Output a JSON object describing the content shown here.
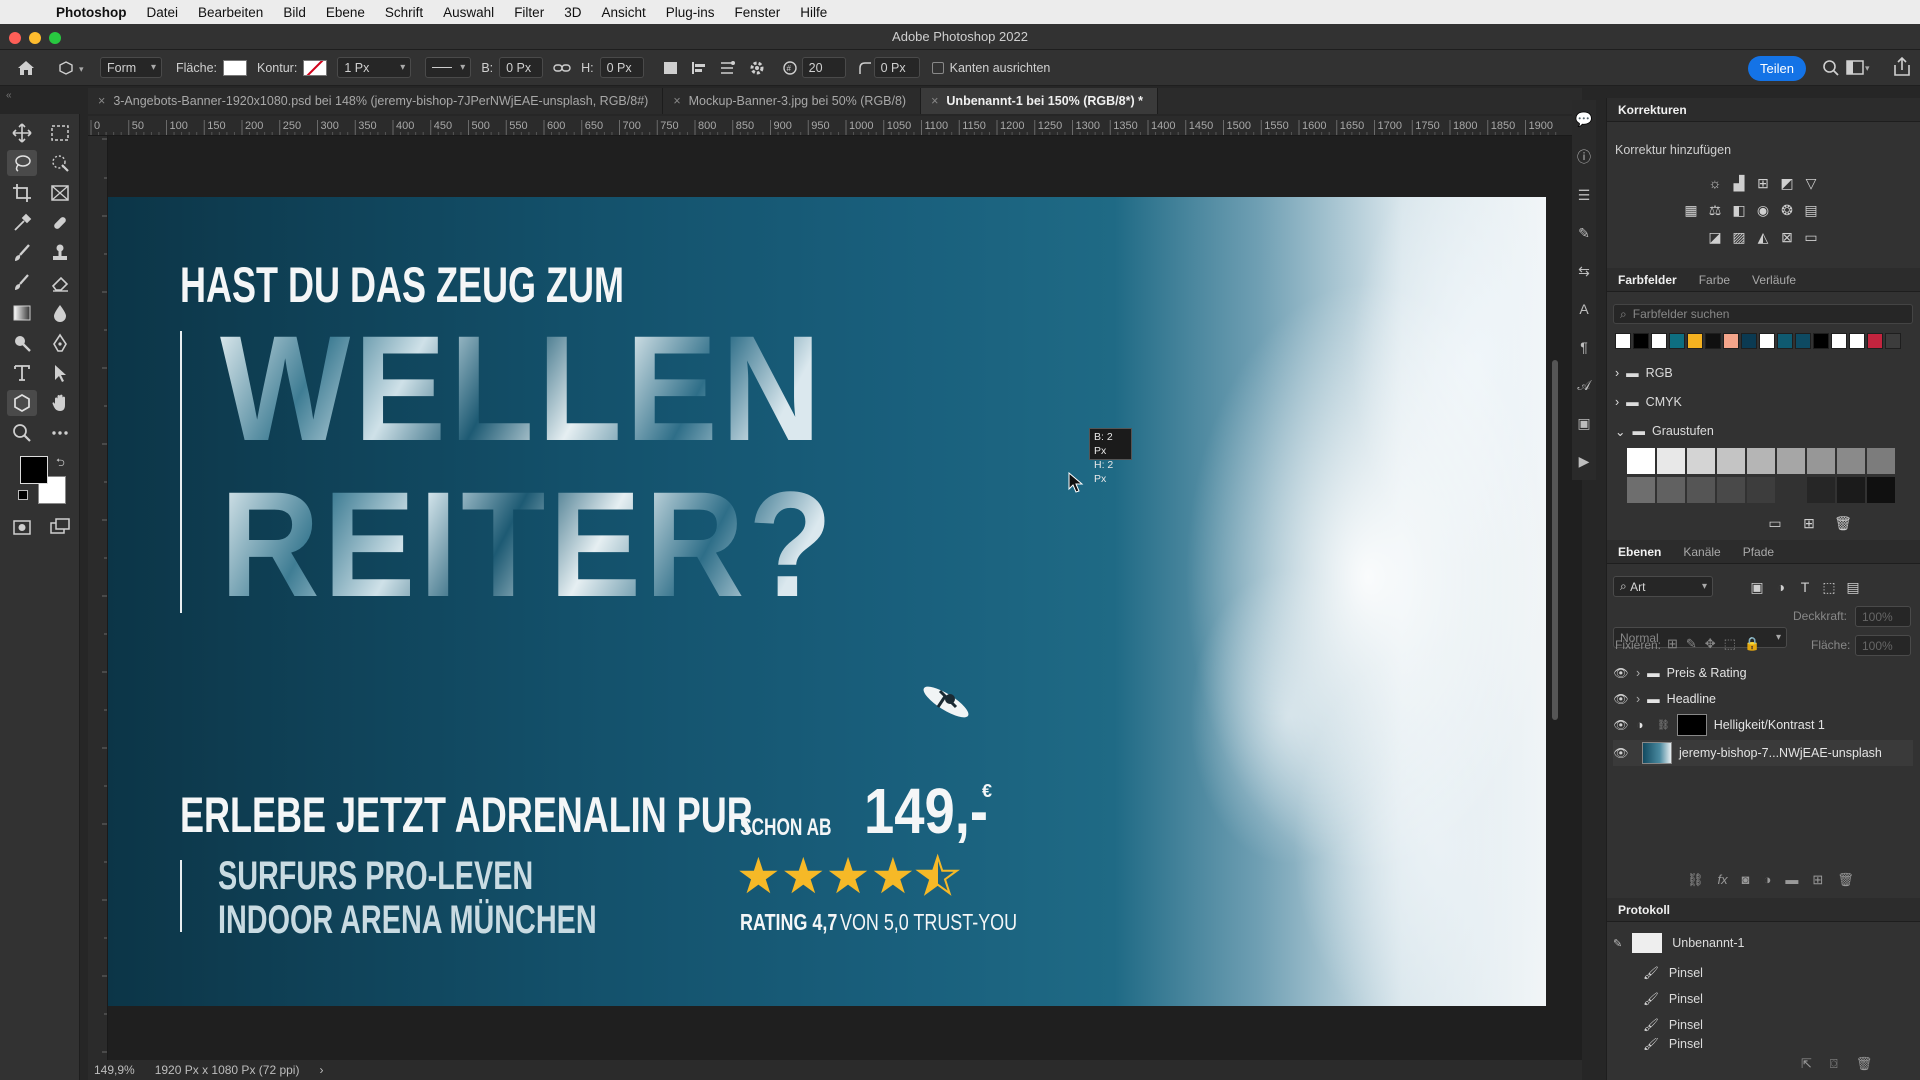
{
  "menubar": {
    "apple": "",
    "app": "Photoshop",
    "items": [
      "Datei",
      "Bearbeiten",
      "Bild",
      "Ebene",
      "Schrift",
      "Auswahl",
      "Filter",
      "3D",
      "Ansicht",
      "Plug-ins",
      "Fenster",
      "Hilfe"
    ]
  },
  "window": {
    "title": "Adobe Photoshop 2022"
  },
  "options": {
    "mode": "Form",
    "fill_label": "Fläche:",
    "stroke_label": "Kontur:",
    "stroke_width": "1 Px",
    "w_label": "B:",
    "w_value": "0 Px",
    "h_label": "H:",
    "h_value": "0 Px",
    "sides": "20",
    "radius": "0 Px",
    "align_edges": "Kanten ausrichten",
    "share": "Teilen"
  },
  "tabs": [
    {
      "label": "3-Angebots-Banner-1920x1080.psd bei 148% (jeremy-bishop-7JPerNWjEAE-unsplash, RGB/8#)",
      "active": false
    },
    {
      "label": "Mockup-Banner-3.jpg bei 50% (RGB/8)",
      "active": false
    },
    {
      "label": "Unbenannt-1 bei 150% (RGB/8*) *",
      "active": true
    }
  ],
  "ruler_ticks": [
    "0",
    "50",
    "100",
    "150",
    "200",
    "250",
    "300",
    "350",
    "400",
    "450",
    "500",
    "550",
    "600",
    "650",
    "700",
    "750",
    "800",
    "850",
    "900",
    "950",
    "1000",
    "1050",
    "1100",
    "1150",
    "1200",
    "1250",
    "1300",
    "1350",
    "1400",
    "1450",
    "1500",
    "1550",
    "1600",
    "1650",
    "1700",
    "1750",
    "1800",
    "1850",
    "1900"
  ],
  "banner": {
    "line1": "HAST DU DAS ZEUG ZUM",
    "big1": "WELLEN",
    "big2": "REITER?",
    "line2": "ERLEBE JETZT ADRENALIN PUR",
    "sub1": "SURFURS PRO-LEVEN",
    "sub2": "INDOOR ARENA MÜNCHEN",
    "from": "SCHON AB",
    "price": "149,-",
    "currency": "€",
    "stars": "★★★★",
    "rating_bold": "RATING 4,7",
    "rating_rest": "VON 5,0 TRUST-YOU"
  },
  "tooltip": {
    "w": "B: 2 Px",
    "h": "H: 2 Px"
  },
  "panels": {
    "corrections": {
      "title": "Korrekturen",
      "add": "Korrektur hinzufügen"
    },
    "swatches": {
      "tabs": [
        "Farbfelder",
        "Farbe",
        "Verläufe"
      ],
      "search": "Farbfelder suchen",
      "colors": [
        "#ffffff",
        "#000000",
        "#ffffff",
        "#0e6e80",
        "#f4b120",
        "#101010",
        "#f4a58b",
        "#0b3a52",
        "#ffffff",
        "#0f5a70",
        "#0e4a62",
        "#000000",
        "#ffffff",
        "#ffffff",
        "#c3243e",
        "#3c3c3c"
      ],
      "groups": [
        "RGB",
        "CMYK",
        "Graustufen"
      ],
      "grays": [
        "#ffffff",
        "#e8e8e8",
        "#d4d4d4",
        "#c4c4c4",
        "#b5b5b5",
        "#a6a6a6",
        "#979797",
        "#8a8a8a",
        "#7c7c7c",
        "#6e6e6e",
        "#616161",
        "#555555",
        "#494949",
        "#3d3d3d",
        "#323232",
        "#262626",
        "#1b1b1b",
        "#101010"
      ]
    },
    "layers": {
      "tabs": [
        "Ebenen",
        "Kanäle",
        "Pfade"
      ],
      "filter": "Art",
      "blend": "Normal",
      "opacity_label": "Deckkraft:",
      "opacity": "100%",
      "lock_label": "Fixieren:",
      "fill_label": "Fläche:",
      "fill": "100%",
      "items": [
        "Preis & Rating",
        "Headline",
        "Helligkeit/Kontrast 1",
        "jeremy-bishop-7...NWjEAE-unsplash"
      ]
    },
    "history": {
      "title": "Protokoll",
      "snapshot": "Unbenannt-1",
      "steps": [
        "Pinsel",
        "Pinsel",
        "Pinsel",
        "Pinsel"
      ]
    }
  },
  "status": {
    "zoom": "149,9%",
    "doc": "1920 Px x 1080 Px (72 ppi)"
  }
}
